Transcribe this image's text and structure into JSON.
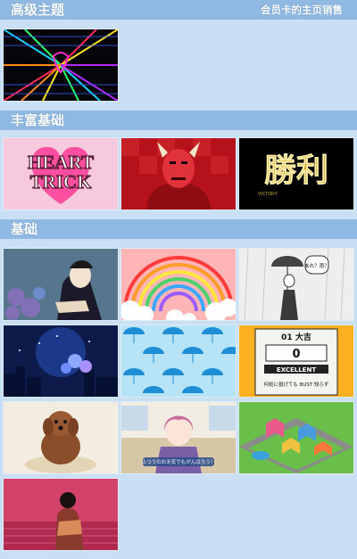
{
  "sections": [
    {
      "title": "高级主题",
      "right_link": "会员卡的主页销售",
      "themes": [
        "neon-grid"
      ]
    },
    {
      "title": "丰富基础",
      "themes": [
        "heart-trick",
        "red-devil",
        "victory-kanji"
      ]
    },
    {
      "title": "基础",
      "themes": [
        "kabuki-hydrangea",
        "rainbow-clouds",
        "manga-umbrella-man",
        "night-city-sparkle",
        "blue-umbrellas",
        "slot-score-card",
        "toy-poodle",
        "anime-girl-office",
        "isometric-city",
        "kimono-sunset"
      ]
    }
  ],
  "tile_text": {
    "heart": [
      "HEART",
      "TRICK"
    ],
    "victory": "勝利",
    "victory_sub": "VICTORY",
    "manga_bubble": "あれ？雨？",
    "slot_header": "01 大吉",
    "slot_score": "0",
    "slot_badge": "EXCELLENT",
    "slot_note": "何処に投げても BUST 知らず",
    "anime_caption": "ふつうのお天気でもがんばろう！"
  },
  "colors": {
    "bg": "#c9dff3",
    "header": "#8fb8e2",
    "heart_pink": "#ff4fa0"
  }
}
